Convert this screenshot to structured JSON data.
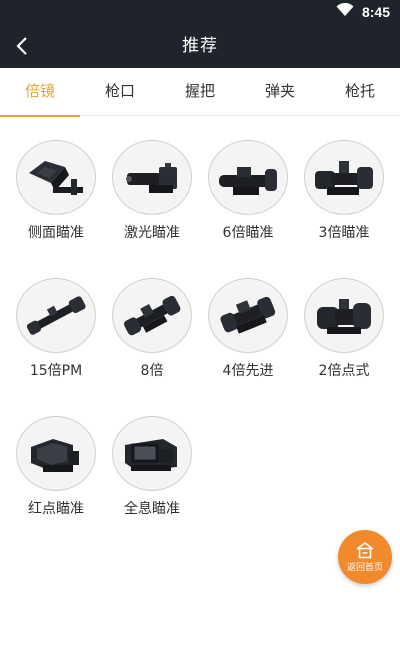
{
  "status": {
    "time": "8:45"
  },
  "header": {
    "title": "推荐"
  },
  "tabs": [
    {
      "label": "倍镜"
    },
    {
      "label": "枪口"
    },
    {
      "label": "握把"
    },
    {
      "label": "弹夹"
    },
    {
      "label": "枪托"
    }
  ],
  "items": [
    {
      "label": "侧面瞄准",
      "icon": "side-sight-icon"
    },
    {
      "label": "激光瞄准",
      "icon": "laser-sight-icon"
    },
    {
      "label": "6倍瞄准",
      "icon": "6x-scope-icon"
    },
    {
      "label": "3倍瞄准",
      "icon": "3x-scope-icon"
    },
    {
      "label": "15倍PM",
      "icon": "15x-pm-scope-icon"
    },
    {
      "label": "8倍",
      "icon": "8x-scope-icon"
    },
    {
      "label": "4倍先进",
      "icon": "4x-acog-scope-icon"
    },
    {
      "label": "2倍点式",
      "icon": "2x-dot-scope-icon"
    },
    {
      "label": "红点瞄准",
      "icon": "red-dot-sight-icon"
    },
    {
      "label": "全息瞄准",
      "icon": "holographic-sight-icon"
    }
  ],
  "home_button": {
    "label": "返回首页"
  },
  "colors": {
    "header_bg": "#1f232b",
    "accent": "#e8a23a",
    "fab": "#f08a2b"
  }
}
